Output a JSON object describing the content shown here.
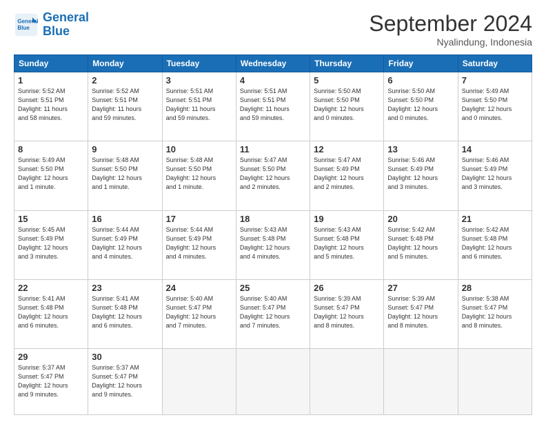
{
  "header": {
    "logo_line1": "General",
    "logo_line2": "Blue",
    "month": "September 2024",
    "location": "Nyalindung, Indonesia"
  },
  "days_of_week": [
    "Sunday",
    "Monday",
    "Tuesday",
    "Wednesday",
    "Thursday",
    "Friday",
    "Saturday"
  ],
  "weeks": [
    [
      {
        "day": "1",
        "info": "Sunrise: 5:52 AM\nSunset: 5:51 PM\nDaylight: 11 hours\nand 58 minutes."
      },
      {
        "day": "2",
        "info": "Sunrise: 5:52 AM\nSunset: 5:51 PM\nDaylight: 11 hours\nand 59 minutes."
      },
      {
        "day": "3",
        "info": "Sunrise: 5:51 AM\nSunset: 5:51 PM\nDaylight: 11 hours\nand 59 minutes."
      },
      {
        "day": "4",
        "info": "Sunrise: 5:51 AM\nSunset: 5:51 PM\nDaylight: 11 hours\nand 59 minutes."
      },
      {
        "day": "5",
        "info": "Sunrise: 5:50 AM\nSunset: 5:50 PM\nDaylight: 12 hours\nand 0 minutes."
      },
      {
        "day": "6",
        "info": "Sunrise: 5:50 AM\nSunset: 5:50 PM\nDaylight: 12 hours\nand 0 minutes."
      },
      {
        "day": "7",
        "info": "Sunrise: 5:49 AM\nSunset: 5:50 PM\nDaylight: 12 hours\nand 0 minutes."
      }
    ],
    [
      {
        "day": "8",
        "info": "Sunrise: 5:49 AM\nSunset: 5:50 PM\nDaylight: 12 hours\nand 1 minute."
      },
      {
        "day": "9",
        "info": "Sunrise: 5:48 AM\nSunset: 5:50 PM\nDaylight: 12 hours\nand 1 minute."
      },
      {
        "day": "10",
        "info": "Sunrise: 5:48 AM\nSunset: 5:50 PM\nDaylight: 12 hours\nand 1 minute."
      },
      {
        "day": "11",
        "info": "Sunrise: 5:47 AM\nSunset: 5:50 PM\nDaylight: 12 hours\nand 2 minutes."
      },
      {
        "day": "12",
        "info": "Sunrise: 5:47 AM\nSunset: 5:49 PM\nDaylight: 12 hours\nand 2 minutes."
      },
      {
        "day": "13",
        "info": "Sunrise: 5:46 AM\nSunset: 5:49 PM\nDaylight: 12 hours\nand 3 minutes."
      },
      {
        "day": "14",
        "info": "Sunrise: 5:46 AM\nSunset: 5:49 PM\nDaylight: 12 hours\nand 3 minutes."
      }
    ],
    [
      {
        "day": "15",
        "info": "Sunrise: 5:45 AM\nSunset: 5:49 PM\nDaylight: 12 hours\nand 3 minutes."
      },
      {
        "day": "16",
        "info": "Sunrise: 5:44 AM\nSunset: 5:49 PM\nDaylight: 12 hours\nand 4 minutes."
      },
      {
        "day": "17",
        "info": "Sunrise: 5:44 AM\nSunset: 5:49 PM\nDaylight: 12 hours\nand 4 minutes."
      },
      {
        "day": "18",
        "info": "Sunrise: 5:43 AM\nSunset: 5:48 PM\nDaylight: 12 hours\nand 4 minutes."
      },
      {
        "day": "19",
        "info": "Sunrise: 5:43 AM\nSunset: 5:48 PM\nDaylight: 12 hours\nand 5 minutes."
      },
      {
        "day": "20",
        "info": "Sunrise: 5:42 AM\nSunset: 5:48 PM\nDaylight: 12 hours\nand 5 minutes."
      },
      {
        "day": "21",
        "info": "Sunrise: 5:42 AM\nSunset: 5:48 PM\nDaylight: 12 hours\nand 6 minutes."
      }
    ],
    [
      {
        "day": "22",
        "info": "Sunrise: 5:41 AM\nSunset: 5:48 PM\nDaylight: 12 hours\nand 6 minutes."
      },
      {
        "day": "23",
        "info": "Sunrise: 5:41 AM\nSunset: 5:48 PM\nDaylight: 12 hours\nand 6 minutes."
      },
      {
        "day": "24",
        "info": "Sunrise: 5:40 AM\nSunset: 5:47 PM\nDaylight: 12 hours\nand 7 minutes."
      },
      {
        "day": "25",
        "info": "Sunrise: 5:40 AM\nSunset: 5:47 PM\nDaylight: 12 hours\nand 7 minutes."
      },
      {
        "day": "26",
        "info": "Sunrise: 5:39 AM\nSunset: 5:47 PM\nDaylight: 12 hours\nand 8 minutes."
      },
      {
        "day": "27",
        "info": "Sunrise: 5:39 AM\nSunset: 5:47 PM\nDaylight: 12 hours\nand 8 minutes."
      },
      {
        "day": "28",
        "info": "Sunrise: 5:38 AM\nSunset: 5:47 PM\nDaylight: 12 hours\nand 8 minutes."
      }
    ],
    [
      {
        "day": "29",
        "info": "Sunrise: 5:37 AM\nSunset: 5:47 PM\nDaylight: 12 hours\nand 9 minutes."
      },
      {
        "day": "30",
        "info": "Sunrise: 5:37 AM\nSunset: 5:47 PM\nDaylight: 12 hours\nand 9 minutes."
      },
      {
        "day": "",
        "info": ""
      },
      {
        "day": "",
        "info": ""
      },
      {
        "day": "",
        "info": ""
      },
      {
        "day": "",
        "info": ""
      },
      {
        "day": "",
        "info": ""
      }
    ]
  ]
}
